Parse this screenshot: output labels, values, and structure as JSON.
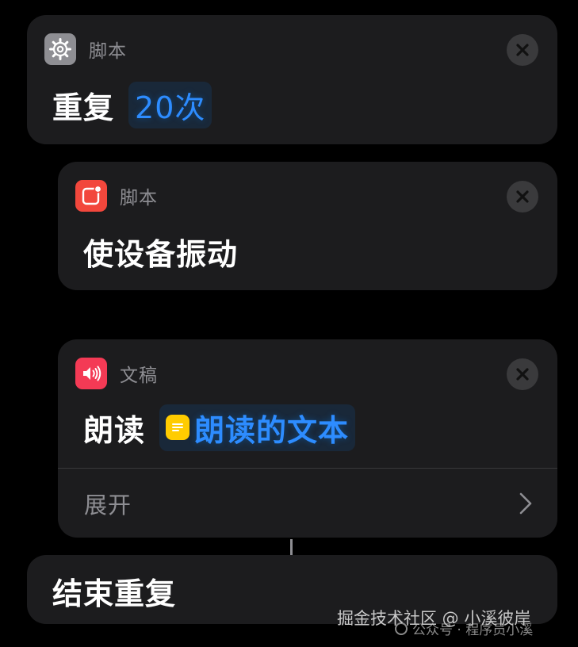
{
  "colors": {
    "background": "#000000",
    "card": "#1c1c1e",
    "accent": "#2d8cff",
    "secondary_text": "#8e8e93",
    "variable_icon": "#ffcc00"
  },
  "actions": [
    {
      "category": "脚本",
      "icon": "gear-icon",
      "verb": "重复",
      "param": "20次"
    },
    {
      "category": "脚本",
      "icon": "device-vibrate-icon",
      "verb": "使设备振动"
    },
    {
      "category": "文稿",
      "icon": "speaker-icon",
      "verb": "朗读",
      "variable_icon": "text-variable-icon",
      "param": "朗读的文本",
      "expand_label": "展开"
    }
  ],
  "end_block": {
    "label": "结束重复"
  },
  "watermark": {
    "primary": "掘金技术社区 @ 小溪彼岸",
    "secondary": "公众号 · 程序员小溪"
  }
}
